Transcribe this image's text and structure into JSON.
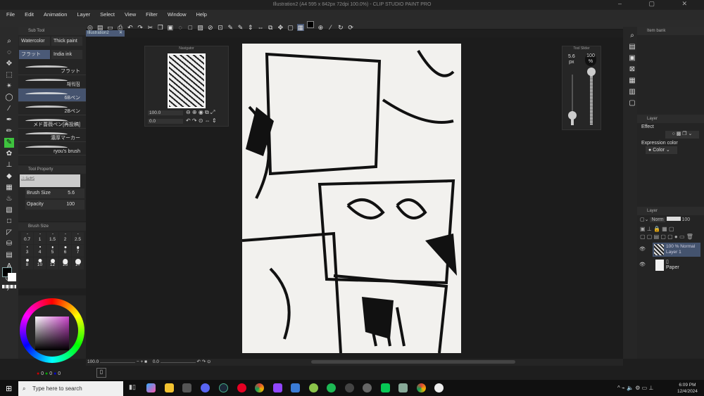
{
  "window": {
    "title": "Illustration2 (A4 595 x 842px 72dpi 100.0%) - CLIP STUDIO PAINT PRO",
    "controls": "– ▢ ✕"
  },
  "menu": [
    "File",
    "Edit",
    "Animation",
    "Layer",
    "Select",
    "View",
    "Filter",
    "Window",
    "Help"
  ],
  "document_tab": {
    "label": "Illustration2",
    "close": "✕"
  },
  "subtool": {
    "title": "Sub Tool",
    "groups": [
      "Watercolor",
      "Thick paint",
      "フラット",
      "India ink"
    ],
    "selected_group": 2,
    "brushes": [
      "フラット",
      "채워짐",
      "6Bペン",
      "2Bペン",
      "メド薔薇ペン[再投稿]",
      "濃厚マーカー",
      "ryou's brush"
    ],
    "selected_brush": 2
  },
  "tool_property": {
    "title": "Tool Property",
    "preview_label": "6Bペン",
    "brush_size_label": "Brush Size",
    "brush_size": "5.6",
    "opacity_label": "Opacity",
    "opacity": "100"
  },
  "brush_size_palette": {
    "title": "Brush Size",
    "sizes": [
      "0.7",
      "1",
      "1.5",
      "2",
      "2.5",
      "3",
      "4",
      "5",
      "6",
      "7",
      "8",
      "10",
      "12",
      "15",
      "17"
    ]
  },
  "color": {
    "main": "#000000",
    "sub": "#ffffff",
    "r": "0",
    "g": "0",
    "b": "0"
  },
  "navigator": {
    "title": "Navigator",
    "zoom": "100.0",
    "rotation": "0.0"
  },
  "tool_slider": {
    "title": "Tool Slider",
    "size": "5.6",
    "size_unit": "px",
    "opacity": "100",
    "opacity_unit": "%",
    "size_fraction": 0.2,
    "opacity_fraction": 1.0
  },
  "statusbar": {
    "zoom": "100.0",
    "rotation": "0.0"
  },
  "item_bank": {
    "title": "Item bank"
  },
  "layer_property": {
    "title": "Layer",
    "effect_label": "Effect",
    "expression_label": "Expression color",
    "expression_value": "Color"
  },
  "layers": {
    "title": "Layer",
    "blend": "Norm",
    "opacity": "100",
    "items": [
      {
        "line1": "100 % Normal",
        "line2": "Layer 1",
        "selected": true
      },
      {
        "line1": "",
        "line2": "Paper",
        "selected": false
      }
    ]
  },
  "taskbar": {
    "search_placeholder": "Type here to search",
    "time": "6:09 PM",
    "date": "12/4/2024"
  }
}
